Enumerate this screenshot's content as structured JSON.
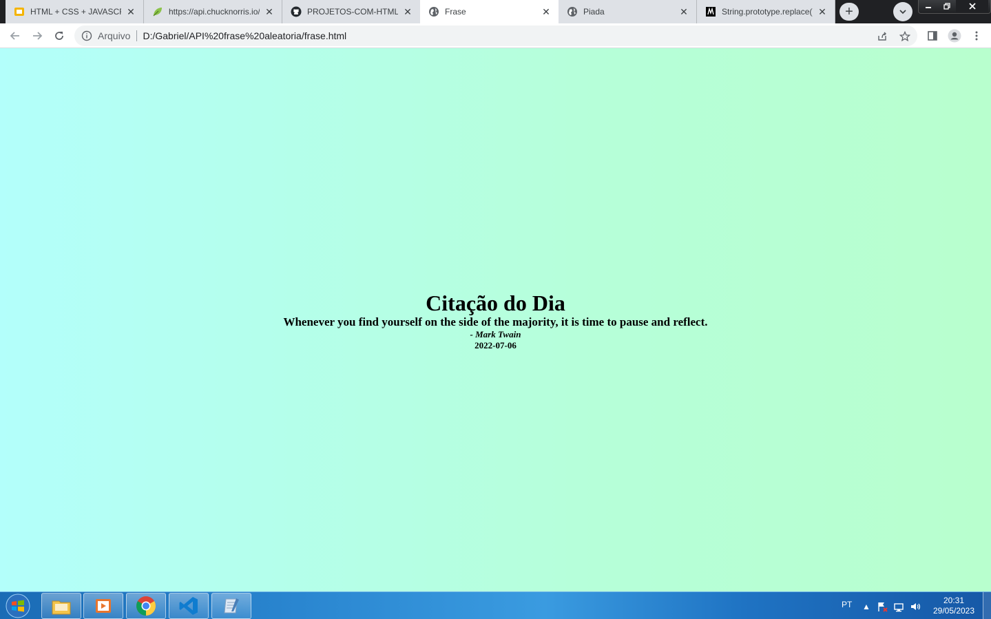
{
  "browser": {
    "tabs": [
      {
        "title": "HTML + CSS + JAVASCRIPT",
        "favicon": "slides-icon",
        "active": false
      },
      {
        "title": "https://api.chucknorris.io/",
        "favicon": "leaf-icon",
        "active": false
      },
      {
        "title": "PROJETOS-COM-HTML_C",
        "favicon": "github-icon",
        "active": false
      },
      {
        "title": "Frase",
        "favicon": "globe-icon",
        "active": true
      },
      {
        "title": "Piada",
        "favicon": "globe-icon",
        "active": false
      },
      {
        "title": "String.prototype.replace()",
        "favicon": "mdn-icon",
        "active": false
      }
    ],
    "new_tab_label": "+",
    "address_bar": {
      "security_label": "Arquivo",
      "url": "D:/Gabriel/API%20frase%20aleatoria/frase.html"
    }
  },
  "page": {
    "title": "Citação do Dia",
    "quote": "Whenever you find yourself on the side of the majority, it is time to pause and reflect.",
    "author": "- Mark Twain",
    "date": "2022-07-06",
    "colors": {
      "gradient_start": "#b3fffb",
      "gradient_end": "#b8ffce"
    }
  },
  "taskbar": {
    "apps": [
      "file-explorer-icon",
      "media-player-icon",
      "chrome-icon",
      "vscode-icon",
      "notepad-icon"
    ],
    "language": "PT",
    "time": "20:31",
    "date": "29/05/2023"
  }
}
